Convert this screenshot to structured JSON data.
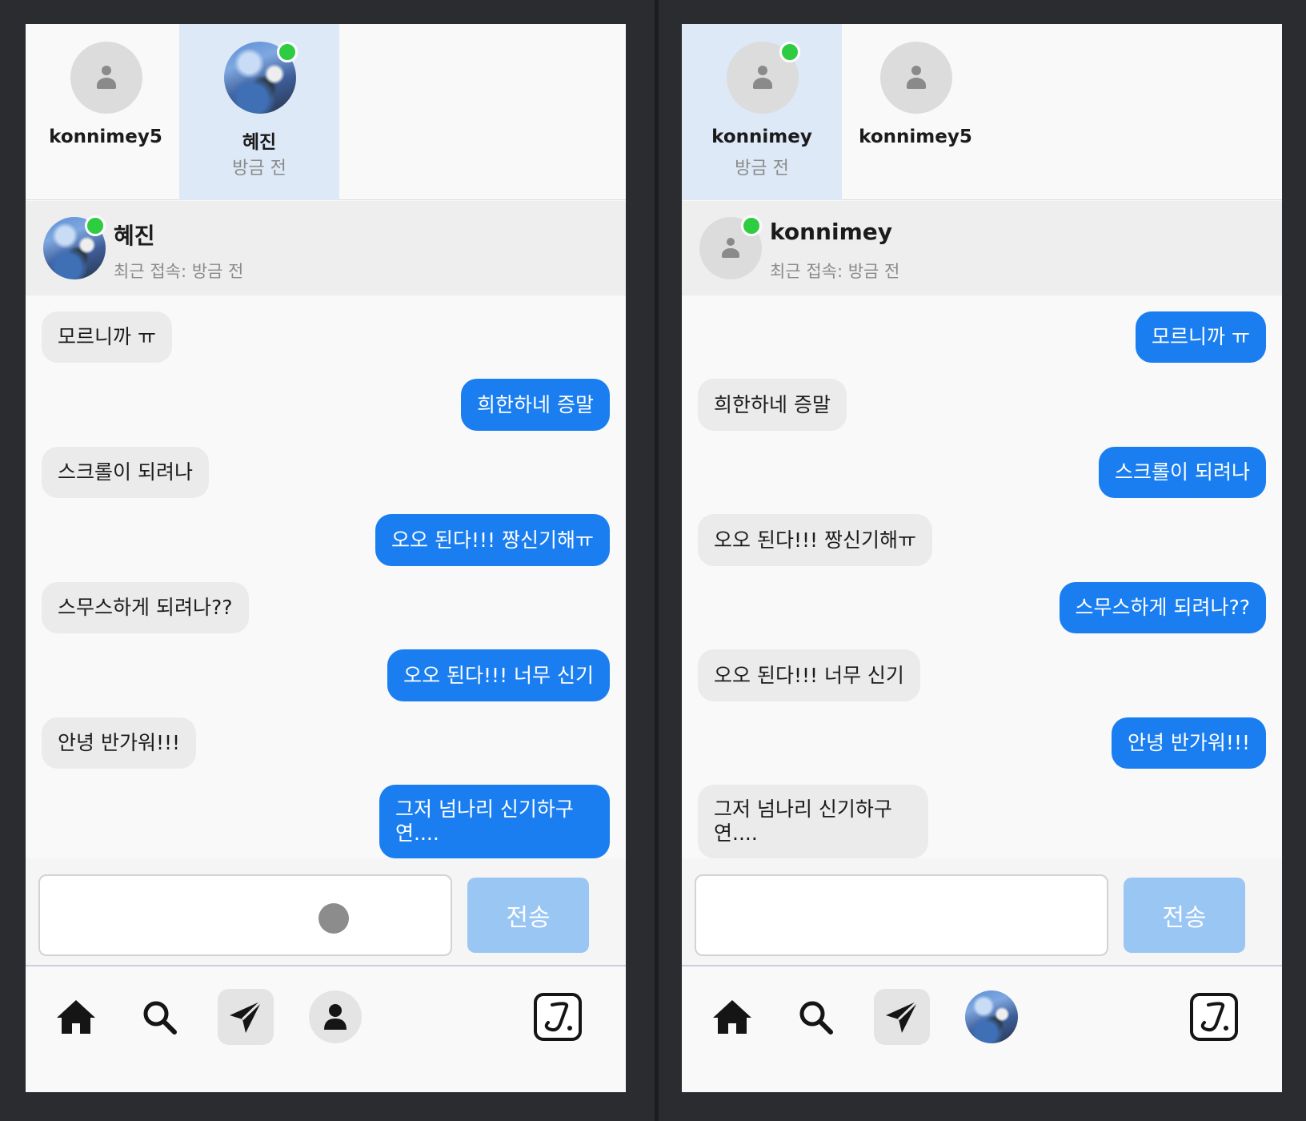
{
  "left": {
    "contacts": [
      {
        "name": "konnimey5",
        "sub": "",
        "active": false,
        "online": false,
        "photo": false
      },
      {
        "name": "혜진",
        "sub": "방금 전",
        "active": true,
        "online": true,
        "photo": true
      }
    ],
    "header": {
      "title": "혜진",
      "status": "최근 접속: 방금 전",
      "online": true,
      "photo": true
    },
    "messages": [
      {
        "text": "모르니까 ㅠ",
        "dir": "recv"
      },
      {
        "text": "희한하네 증말",
        "dir": "sent"
      },
      {
        "text": "스크롤이 되려나",
        "dir": "recv"
      },
      {
        "text": "오오 된다!!! 짱신기해ㅠ",
        "dir": "sent"
      },
      {
        "text": "스무스하게 되려나??",
        "dir": "recv"
      },
      {
        "text": "오오 된다!!! 너무 신기",
        "dir": "sent"
      },
      {
        "text": "안녕 반가워!!!",
        "dir": "recv"
      },
      {
        "text": "그저 넘나리 신기하구\n연....",
        "dir": "sent"
      }
    ],
    "composer": {
      "input_value": "",
      "send_label": "전송"
    },
    "nav": {
      "profile_photo": false
    }
  },
  "right": {
    "contacts": [
      {
        "name": "konnimey",
        "sub": "방금 전",
        "active": true,
        "online": true,
        "photo": false
      },
      {
        "name": "konnimey5",
        "sub": "",
        "active": false,
        "online": false,
        "photo": false
      }
    ],
    "header": {
      "title": "konnimey",
      "status": "최근 접속: 방금 전",
      "online": true,
      "photo": false
    },
    "messages": [
      {
        "text": "모르니까 ㅠ",
        "dir": "sent"
      },
      {
        "text": "희한하네 증말",
        "dir": "recv"
      },
      {
        "text": "스크롤이 되려나",
        "dir": "sent"
      },
      {
        "text": "오오 된다!!! 짱신기해ㅠ",
        "dir": "recv"
      },
      {
        "text": "스무스하게 되려나??",
        "dir": "sent"
      },
      {
        "text": "오오 된다!!! 너무 신기",
        "dir": "recv"
      },
      {
        "text": "안녕 반가워!!!",
        "dir": "sent"
      },
      {
        "text": "그저 넘나리 신기하구\n연....",
        "dir": "recv"
      }
    ],
    "composer": {
      "input_value": "",
      "send_label": "전송"
    },
    "nav": {
      "profile_photo": true
    }
  },
  "nav_icons": [
    "home-icon",
    "search-icon",
    "send-icon",
    "profile-icon",
    "app-logo-icon"
  ],
  "colors": {
    "accent": "#1a7ef0",
    "send_disabled": "#9ac6f4",
    "online": "#2ecc40",
    "active_contact": "#dde9f7"
  }
}
